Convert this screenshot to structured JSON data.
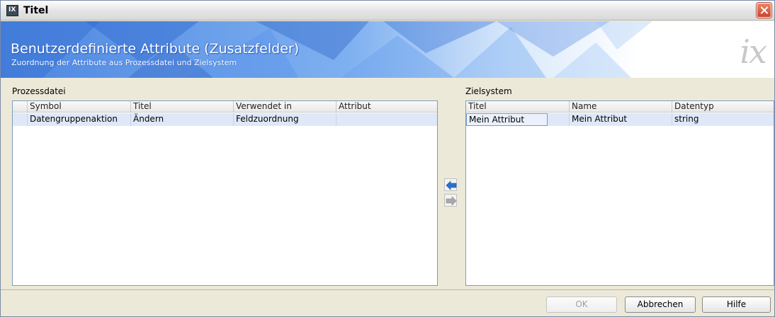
{
  "window": {
    "title": "Titel"
  },
  "banner": {
    "title": "Benutzerdefinierte Attribute (Zusatzfelder)",
    "subtitle": "Zuordnung der Attribute aus Prozessdatei und Zielsystem",
    "logo": "ix"
  },
  "left": {
    "label": "Prozessdatei",
    "columns": [
      "Symbol",
      "Titel",
      "Verwendet in",
      "Attribut"
    ],
    "rows": [
      [
        "Datengruppenaktion",
        "Ändern",
        "Feldzuordnung",
        ""
      ]
    ]
  },
  "right": {
    "label": "Zielsystem",
    "columns": [
      "Titel",
      "Name",
      "Datentyp"
    ],
    "rows": [
      [
        "Mein Attribut",
        "Mein Attribut",
        "string"
      ]
    ]
  },
  "buttons": {
    "ok": "OK",
    "cancel": "Abbrechen",
    "help": "Hilfe"
  },
  "colors": {
    "arrow_blue": "#2a72c8",
    "arrow_gray": "#a9a9a9",
    "selection": "#dfe8f8",
    "banner_blue": "#3f7fe0"
  }
}
